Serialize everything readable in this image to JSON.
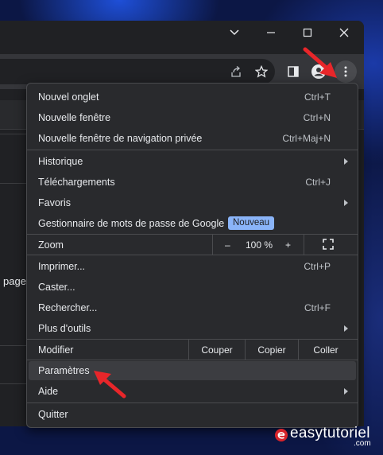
{
  "menu": {
    "new_tab": {
      "label": "Nouvel onglet",
      "shortcut": "Ctrl+T"
    },
    "new_window": {
      "label": "Nouvelle fenêtre",
      "shortcut": "Ctrl+N"
    },
    "incognito": {
      "label": "Nouvelle fenêtre de navigation privée",
      "shortcut": "Ctrl+Maj+N"
    },
    "history": {
      "label": "Historique"
    },
    "downloads": {
      "label": "Téléchargements",
      "shortcut": "Ctrl+J"
    },
    "bookmarks": {
      "label": "Favoris"
    },
    "password_manager": {
      "label": "Gestionnaire de mots de passe de Google",
      "badge": "Nouveau"
    },
    "zoom": {
      "label": "Zoom",
      "minus": "–",
      "value": "100 %",
      "plus": "+"
    },
    "print": {
      "label": "Imprimer...",
      "shortcut": "Ctrl+P"
    },
    "cast": {
      "label": "Caster..."
    },
    "find": {
      "label": "Rechercher...",
      "shortcut": "Ctrl+F"
    },
    "more_tools": {
      "label": "Plus d'outils"
    },
    "edit": {
      "label": "Modifier",
      "cut": "Couper",
      "copy": "Copier",
      "paste": "Coller"
    },
    "settings": {
      "label": "Paramètres"
    },
    "help": {
      "label": "Aide"
    },
    "quit": {
      "label": "Quitter"
    }
  },
  "page": {
    "fragment": "page"
  },
  "watermark": {
    "name": "easytutoriel",
    "tld": ".com"
  },
  "colors": {
    "accent_badge": "#8ab4f8",
    "annotation_arrow": "#e8262a",
    "menu_bg": "#292a2d"
  }
}
